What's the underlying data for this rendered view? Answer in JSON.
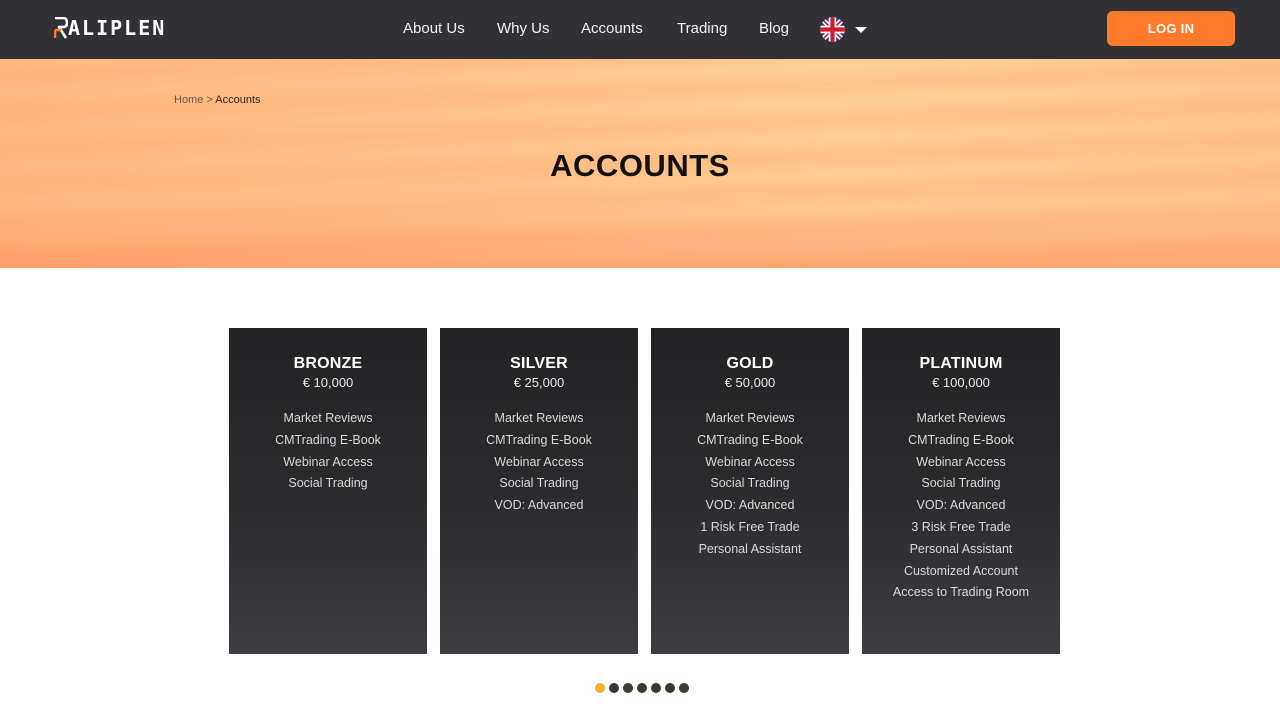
{
  "header": {
    "logo_text": "ALIPLEN",
    "nav": [
      {
        "label": "About Us"
      },
      {
        "label": "Why Us"
      },
      {
        "label": "Accounts"
      },
      {
        "label": "Trading"
      },
      {
        "label": "Blog"
      }
    ],
    "language_icon": "uk-flag-icon",
    "login_label": "LOG IN"
  },
  "hero": {
    "breadcrumb": {
      "home": "Home",
      "separator": ">",
      "current": "Accounts"
    },
    "title": "ACCOUNTS"
  },
  "accounts": [
    {
      "name": "BRONZE",
      "price": "€ 10,000",
      "features": [
        "Market Reviews",
        "CMTrading E-Book",
        "Webinar Access",
        "Social Trading"
      ]
    },
    {
      "name": "SILVER",
      "price": "€ 25,000",
      "features": [
        "Market Reviews",
        "CMTrading E-Book",
        "Webinar Access",
        "Social Trading",
        "VOD: Advanced"
      ]
    },
    {
      "name": "GOLD",
      "price": "€ 50,000",
      "features": [
        "Market Reviews",
        "CMTrading E-Book",
        "Webinar Access",
        "Social Trading",
        "VOD: Advanced",
        "1 Risk Free Trade",
        "Personal Assistant"
      ]
    },
    {
      "name": "PLATINUM",
      "price": "€ 100,000",
      "features": [
        "Market Reviews",
        "CMTrading E-Book",
        "Webinar Access",
        "Social Trading",
        "VOD: Advanced",
        "3 Risk Free Trade",
        "Personal Assistant",
        "Customized Account",
        "Access to Trading Room"
      ]
    }
  ],
  "pagination": {
    "count": 7,
    "active_index": 0,
    "active_color": "#f5b22d",
    "inactive_color": "#3c3a33"
  },
  "colors": {
    "header_bg": "#323236",
    "accent": "#ff7a2a",
    "card_bg": "#2b2b2e"
  }
}
